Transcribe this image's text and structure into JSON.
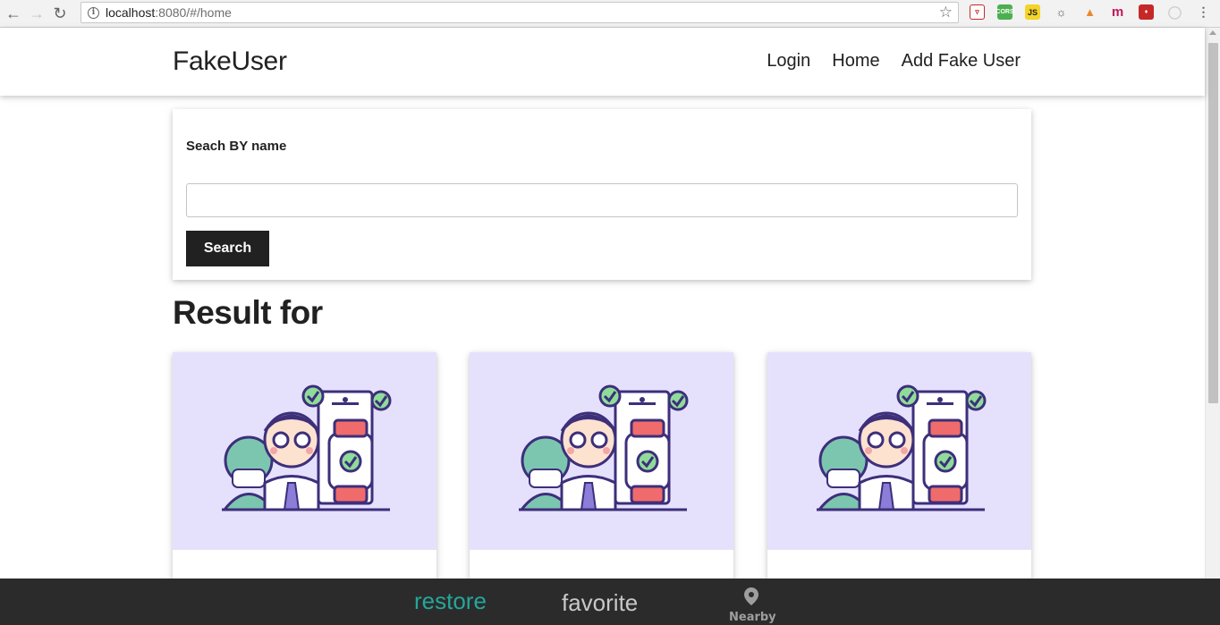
{
  "browser": {
    "url_host": "localhost",
    "url_rest": ":8080/#/home"
  },
  "header": {
    "brand": "FakeUser",
    "nav": [
      "Login",
      "Home",
      "Add Fake User"
    ]
  },
  "search": {
    "label": "Seach BY name",
    "value": "",
    "button_label": "Search"
  },
  "results": {
    "heading": "Result for",
    "cards": 3
  },
  "bottom_nav": {
    "restore_label": "restore",
    "favorite_label": "favorite",
    "nearby_label": "Nearby",
    "accent_color": "#26a69a"
  },
  "colors": {
    "card_image_bg": "#e5e1fd",
    "dark": "#212121"
  }
}
